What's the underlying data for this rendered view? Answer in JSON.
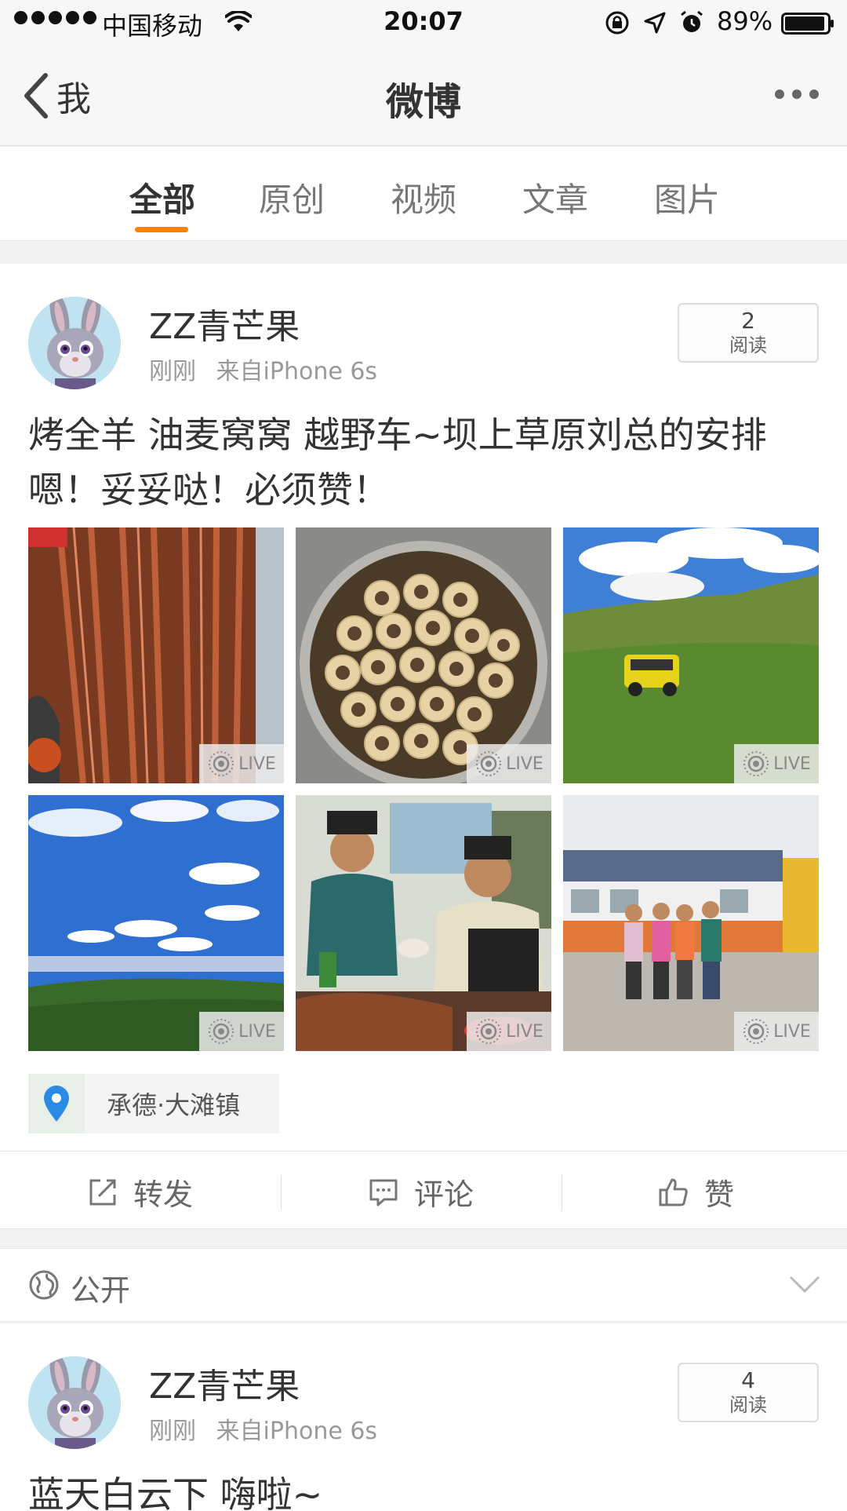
{
  "status_bar": {
    "carrier": "中国移动",
    "time": "20:07",
    "battery": "89%"
  },
  "nav": {
    "back_label": "我",
    "title": "微博"
  },
  "tabs": [
    {
      "label": "全部",
      "active": true
    },
    {
      "label": "原创",
      "active": false
    },
    {
      "label": "视频",
      "active": false
    },
    {
      "label": "文章",
      "active": false
    },
    {
      "label": "图片",
      "active": false
    }
  ],
  "posts": [
    {
      "username": "ZZ青芒果",
      "time": "刚刚",
      "source": "来自iPhone 6s",
      "read_count": "2",
      "read_label": "阅读",
      "text": "烤全羊  油麦窝窝  越野车~坝上草原刘总的安排  嗯！妥妥哒！必须赞！",
      "photos": [
        {
          "subject": "roast-lamb",
          "badge": "LIVE"
        },
        {
          "subject": "youmian-wowo",
          "badge": "LIVE"
        },
        {
          "subject": "jeep-on-grassland",
          "badge": "LIVE"
        },
        {
          "subject": "blue-sky-hills",
          "badge": "LIVE"
        },
        {
          "subject": "men-carving-lamb",
          "badge": "LIVE"
        },
        {
          "subject": "group-photo",
          "badge": "LIVE"
        }
      ],
      "location": "承德·大滩镇",
      "actions": {
        "repost": "转发",
        "comment": "评论",
        "like": "赞"
      }
    },
    {
      "username": "ZZ青芒果",
      "time": "刚刚",
      "source": "来自iPhone 6s",
      "read_count": "4",
      "read_label": "阅读",
      "text": "蓝天白云下  嗨啦~"
    }
  ],
  "visibility": {
    "label": "公开"
  },
  "colors": {
    "accent": "#ff8200",
    "background": "#f2f2f2"
  }
}
